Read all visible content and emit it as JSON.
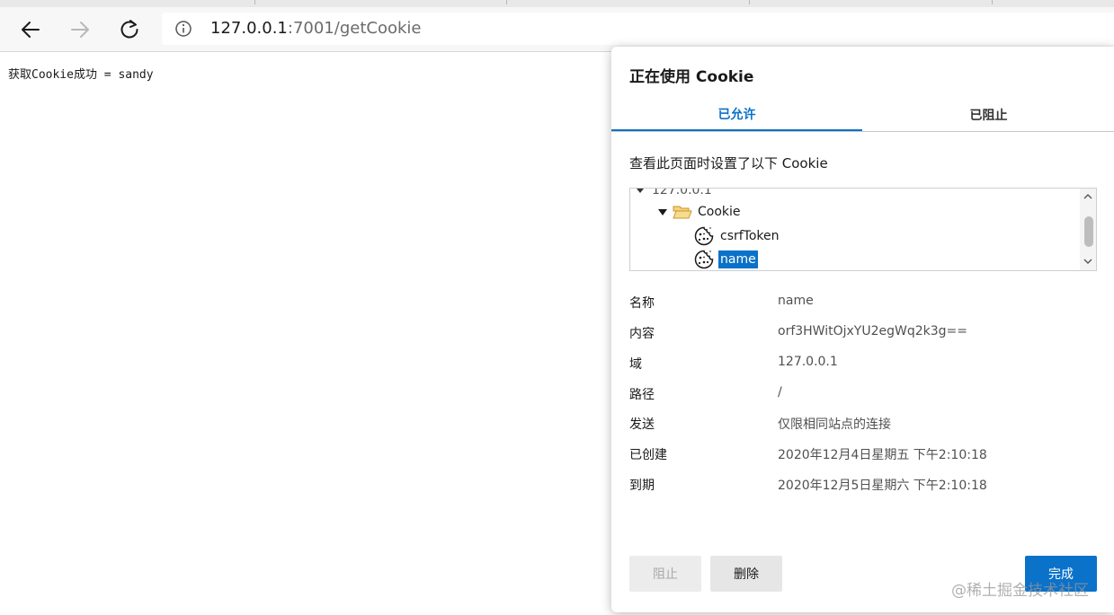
{
  "browser": {
    "url_host": "127.0.0.1",
    "url_rest": ":7001/getCookie"
  },
  "page": {
    "body_text": "获取Cookie成功 = sandy"
  },
  "dialog": {
    "title": "正在使用 Cookie",
    "tabs": [
      {
        "label": "已允许",
        "active": true
      },
      {
        "label": "已阻止",
        "active": false
      }
    ],
    "description": "查看此页面时设置了以下 Cookie",
    "tree": {
      "site": "127.0.0.1",
      "folder": "Cookie",
      "cookies": [
        {
          "name": "csrfToken",
          "selected": false
        },
        {
          "name": "name",
          "selected": true
        }
      ]
    },
    "details": [
      {
        "key": "名称",
        "value": "name"
      },
      {
        "key": "内容",
        "value": "orf3HWitOjxYU2egWq2k3g=="
      },
      {
        "key": "域",
        "value": "127.0.0.1"
      },
      {
        "key": "路径",
        "value": "/"
      },
      {
        "key": "发送",
        "value": "仅限相同站点的连接"
      },
      {
        "key": "已创建",
        "value": "2020年12月4日星期五 下午2:10:18"
      },
      {
        "key": "到期",
        "value": "2020年12月5日星期六 下午2:10:18"
      }
    ],
    "buttons": {
      "block": "阻止",
      "delete": "删除",
      "done": "完成"
    }
  },
  "watermark": "@稀土掘金技术社区",
  "colors": {
    "accent": "#0b72c9",
    "folder": "#e8b84a"
  },
  "icons": [
    "back-arrow-icon",
    "forward-arrow-icon",
    "refresh-icon",
    "info-icon",
    "folder-open-icon",
    "cookie-icon",
    "chevron-up-icon",
    "chevron-down-icon",
    "triangle-expand-icon"
  ]
}
